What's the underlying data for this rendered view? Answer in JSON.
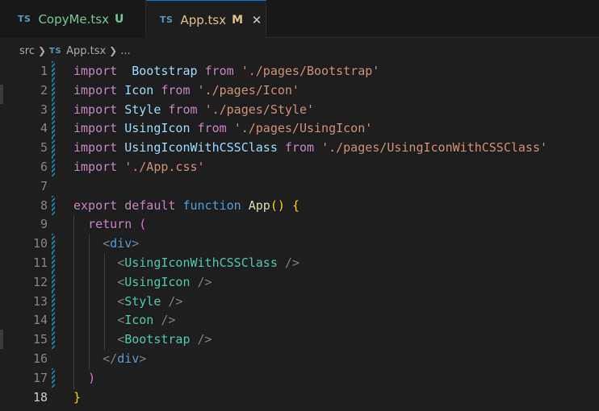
{
  "tabs": [
    {
      "badge": "TS",
      "name": "CopyMe.tsx",
      "status": "U"
    },
    {
      "badge": "TS",
      "name": "App.tsx",
      "status": "M",
      "close": "✕"
    }
  ],
  "breadcrumb": {
    "folder": "src",
    "badge": "TS",
    "file": "App.tsx",
    "more": "..."
  },
  "lines": [
    {
      "n": "1",
      "tokens": [
        [
          "kw-i",
          "import"
        ],
        [
          "",
          "  "
        ],
        [
          "id",
          "Bootstrap"
        ],
        [
          "",
          ""
        ],
        [
          "kw-i",
          "from"
        ],
        [
          "",
          ""
        ],
        [
          "str",
          "'./pages/Bootstrap'"
        ]
      ]
    },
    {
      "n": "2",
      "tokens": [
        [
          "kw-i",
          "import"
        ],
        [
          "",
          ""
        ],
        [
          "id",
          "Icon"
        ],
        [
          "",
          ""
        ],
        [
          "kw-i",
          "from"
        ],
        [
          "",
          ""
        ],
        [
          "str",
          "'./pages/Icon'"
        ]
      ]
    },
    {
      "n": "3",
      "tokens": [
        [
          "kw-i",
          "import"
        ],
        [
          "",
          ""
        ],
        [
          "id",
          "Style"
        ],
        [
          "",
          ""
        ],
        [
          "kw-i",
          "from"
        ],
        [
          "",
          ""
        ],
        [
          "str",
          "'./pages/Style'"
        ]
      ]
    },
    {
      "n": "4",
      "tokens": [
        [
          "kw-i",
          "import"
        ],
        [
          "",
          ""
        ],
        [
          "id",
          "UsingIcon"
        ],
        [
          "",
          ""
        ],
        [
          "kw-i",
          "from"
        ],
        [
          "",
          ""
        ],
        [
          "str",
          "'./pages/UsingIcon'"
        ]
      ]
    },
    {
      "n": "5",
      "tokens": [
        [
          "kw-i",
          "import"
        ],
        [
          "",
          ""
        ],
        [
          "id",
          "UsingIconWithCSSClass"
        ],
        [
          "",
          ""
        ],
        [
          "kw-i",
          "from"
        ],
        [
          "",
          ""
        ],
        [
          "str",
          "'./pages/UsingIconWithCSSClass'"
        ]
      ]
    },
    {
      "n": "6",
      "tokens": [
        [
          "kw-i",
          "import"
        ],
        [
          "",
          ""
        ],
        [
          "str",
          "'./App.css'"
        ]
      ]
    },
    {
      "n": "7",
      "tokens": []
    },
    {
      "n": "8",
      "tokens": [
        [
          "kw-i",
          "export"
        ],
        [
          "",
          ""
        ],
        [
          "kw-i",
          "default"
        ],
        [
          "",
          ""
        ],
        [
          "kw-b",
          "function"
        ],
        [
          "",
          ""
        ],
        [
          "fn",
          "App"
        ],
        [
          "br1",
          "()"
        ],
        [
          "",
          ""
        ],
        [
          "br1",
          "{"
        ]
      ]
    },
    {
      "n": "9",
      "tokens": [
        [
          "",
          "  "
        ],
        [
          "kw-i",
          "return"
        ],
        [
          "",
          ""
        ],
        [
          "br2",
          "("
        ]
      ]
    },
    {
      "n": "10",
      "tokens": [
        [
          "",
          "    "
        ],
        [
          "tag",
          "<"
        ],
        [
          "tagn",
          "div"
        ],
        [
          "tag",
          ">"
        ]
      ]
    },
    {
      "n": "11",
      "tokens": [
        [
          "",
          "      "
        ],
        [
          "tag",
          "<"
        ],
        [
          "comp",
          "UsingIconWithCSSClass"
        ],
        [
          "",
          ""
        ],
        [
          "tag",
          "/>"
        ]
      ]
    },
    {
      "n": "12",
      "tokens": [
        [
          "",
          "      "
        ],
        [
          "tag",
          "<"
        ],
        [
          "comp",
          "UsingIcon"
        ],
        [
          "",
          ""
        ],
        [
          "tag",
          "/>"
        ]
      ]
    },
    {
      "n": "13",
      "tokens": [
        [
          "",
          "      "
        ],
        [
          "tag",
          "<"
        ],
        [
          "comp",
          "Style"
        ],
        [
          "",
          ""
        ],
        [
          "tag",
          "/>"
        ]
      ]
    },
    {
      "n": "14",
      "tokens": [
        [
          "",
          "      "
        ],
        [
          "tag",
          "<"
        ],
        [
          "comp",
          "Icon"
        ],
        [
          "",
          ""
        ],
        [
          "tag",
          "/>"
        ]
      ]
    },
    {
      "n": "15",
      "tokens": [
        [
          "",
          "      "
        ],
        [
          "tag",
          "<"
        ],
        [
          "comp",
          "Bootstrap"
        ],
        [
          "",
          ""
        ],
        [
          "tag",
          "/>"
        ]
      ]
    },
    {
      "n": "16",
      "tokens": [
        [
          "",
          "    "
        ],
        [
          "tag",
          "</"
        ],
        [
          "tagn",
          "div"
        ],
        [
          "tag",
          ">"
        ]
      ]
    },
    {
      "n": "17",
      "tokens": [
        [
          "",
          "  "
        ],
        [
          "br2",
          ")"
        ]
      ]
    },
    {
      "n": "18",
      "tokens": [
        [
          "br1",
          "}"
        ]
      ]
    }
  ],
  "modified_lines": [
    "1",
    "2",
    "3",
    "4",
    "5",
    "6",
    "8",
    "10",
    "11",
    "12",
    "13",
    "14",
    "15",
    "17"
  ],
  "active_line": "18"
}
